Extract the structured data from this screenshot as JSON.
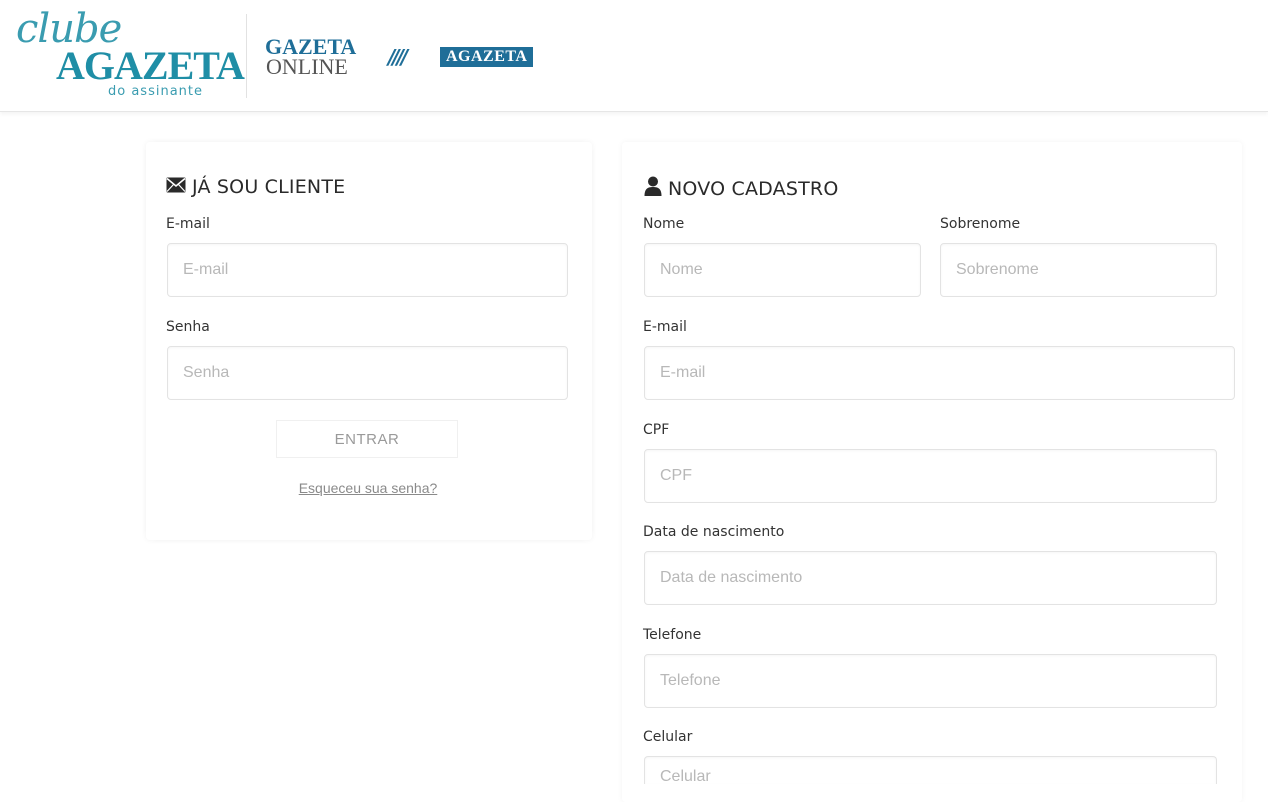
{
  "header": {
    "logo_clube": {
      "script": "clube",
      "brand": "AGAZETA",
      "tagline": "do assinante"
    },
    "logo_gazeta_online": {
      "line1": "GAZETA",
      "line2": "ONLINE"
    },
    "logo_agazeta": {
      "bars": "////",
      "text": "AGAZETA"
    }
  },
  "login": {
    "title": "JÁ SOU CLIENTE",
    "title_icon": "envelope-icon",
    "email_label": "E-mail",
    "email_placeholder": "E-mail",
    "password_label": "Senha",
    "password_placeholder": "Senha",
    "submit_label": "ENTRAR",
    "forgot_label": "Esqueceu sua senha?"
  },
  "register": {
    "title": "NOVO CADASTRO",
    "title_icon": "user-icon",
    "first_name_label": "Nome",
    "first_name_placeholder": "Nome",
    "last_name_label": "Sobrenome",
    "last_name_placeholder": "Sobrenome",
    "email_label": "E-mail",
    "email_placeholder": "E-mail",
    "cpf_label": "CPF",
    "cpf_placeholder": "CPF",
    "birthdate_label": "Data de nascimento",
    "birthdate_placeholder": "Data de nascimento",
    "phone_label": "Telefone",
    "phone_placeholder": "Telefone",
    "mobile_label": "Celular",
    "mobile_placeholder": "Celular"
  },
  "colors": {
    "brand_teal": "#1f8ea6",
    "brand_blue": "#1f6e98"
  }
}
